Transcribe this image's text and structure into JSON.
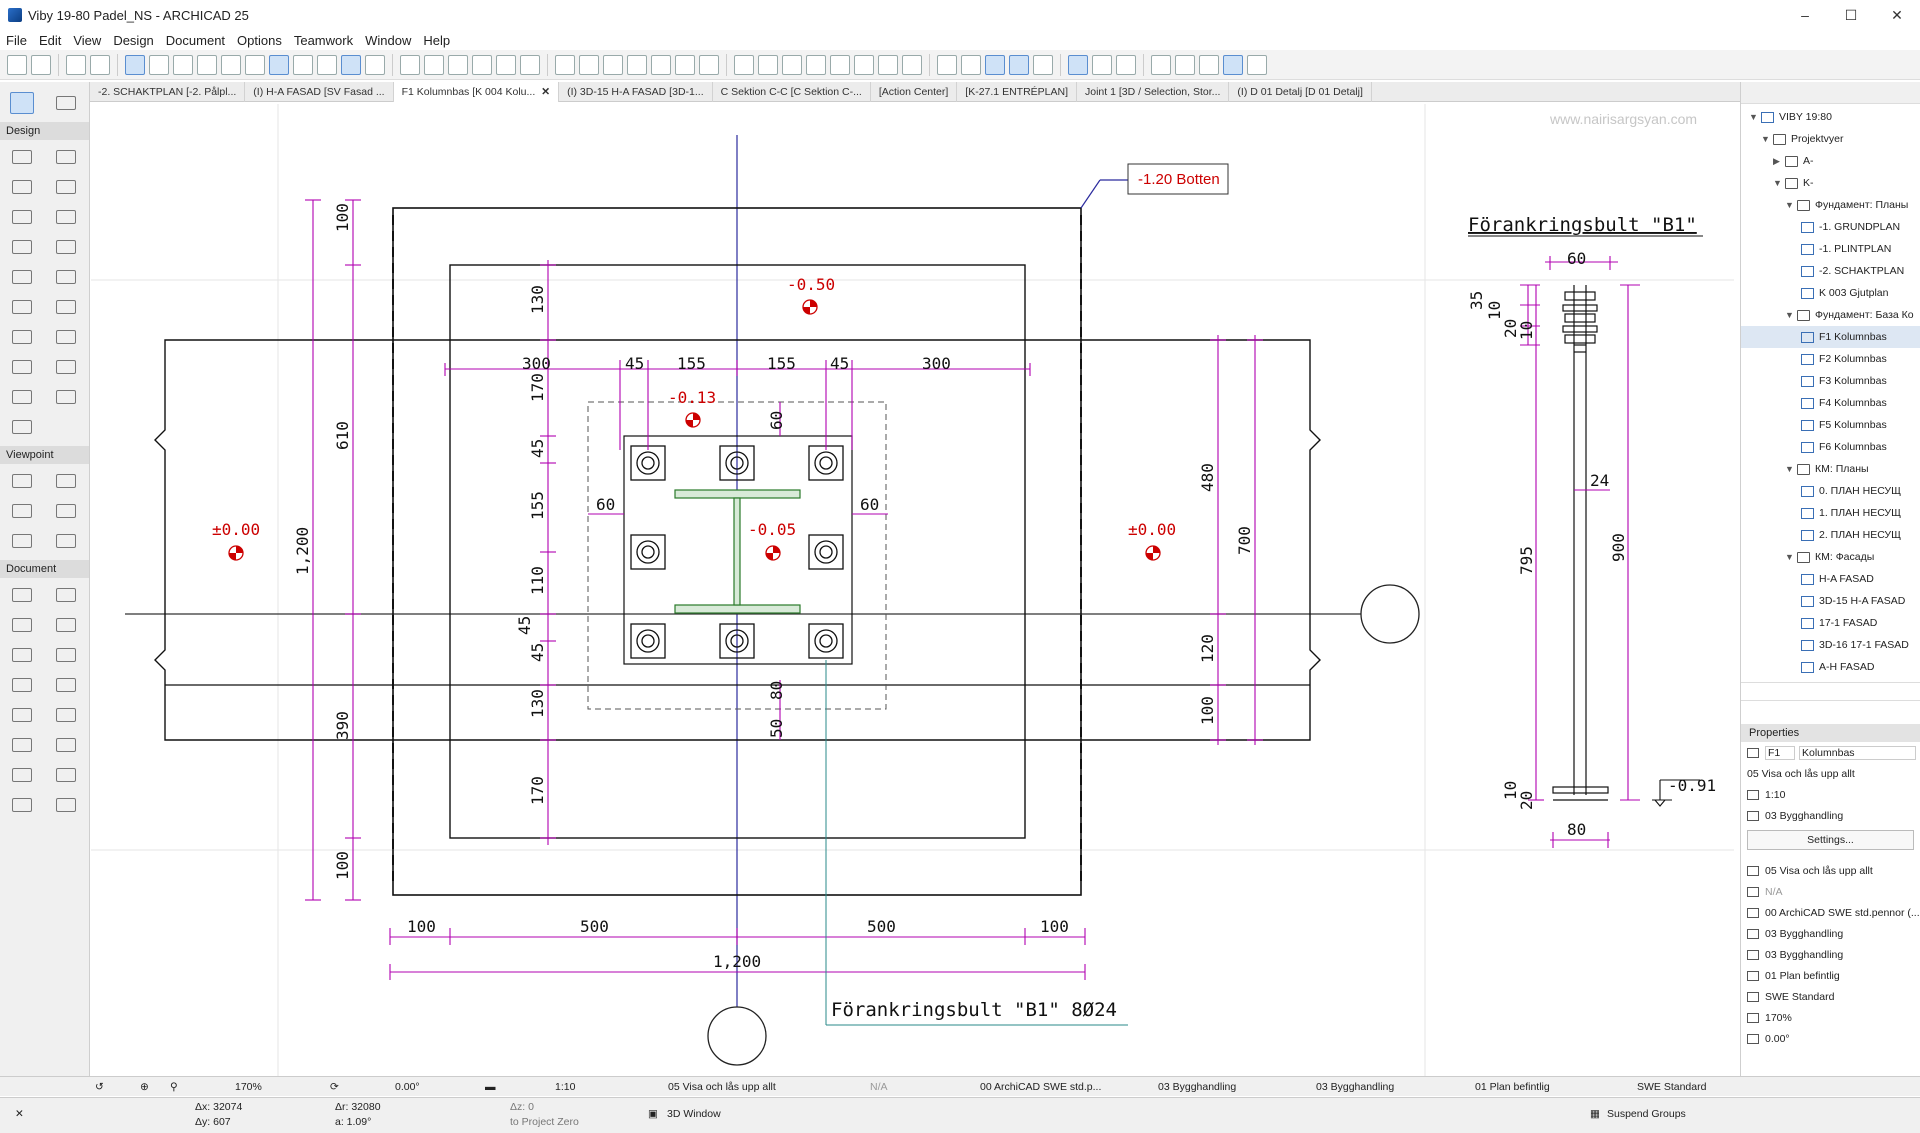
{
  "window": {
    "title": "Viby 19-80 Padel_NS - ARCHICAD 25"
  },
  "menu": [
    "File",
    "Edit",
    "View",
    "Design",
    "Document",
    "Options",
    "Teamwork",
    "Window",
    "Help"
  ],
  "tabs": [
    {
      "label": "-2. SCHAKTPLAN [-2. Pålpl...",
      "active": false
    },
    {
      "label": "(I) H-A FASAD  [SV Fasad ...",
      "active": false
    },
    {
      "label": "F1 Kolumnbas [K 004 Kolu...",
      "active": true
    },
    {
      "label": "(I) 3D-15 H-A FASAD [3D-1...",
      "active": false
    },
    {
      "label": "C Sektion C-C [C Sektion C-...",
      "active": false
    },
    {
      "label": "[Action Center]",
      "active": false
    },
    {
      "label": "[K-27.1 ENTRÉPLAN]",
      "active": false
    },
    {
      "label": "Joint 1 [3D / Selection, Stor...",
      "active": false
    },
    {
      "label": "(I) D 01 Detalj [D 01 Detalj]",
      "active": false
    }
  ],
  "toolbox": {
    "design": "Design",
    "viewpoint": "Viewpoint",
    "document": "Document"
  },
  "watermark": "www.nairisargsyan.com",
  "drawing": {
    "levels": [
      "-0.50",
      "-0.13",
      "-0.05",
      "±0.00",
      "±0.00"
    ],
    "callout": "-1.20 Botten",
    "detail_title": "Förankringsbult \"B1\"",
    "bolt_label": "Förankringsbult \"B1\" 8Ø24",
    "bolt_level": "-0.91",
    "dims_top": [
      "300",
      "45",
      "155",
      "155",
      "45",
      "300"
    ],
    "dims_bottom": [
      "100",
      "500",
      "500",
      "100"
    ],
    "dim_total_bottom": "1,200",
    "dims_left_outer": [
      "100",
      "610",
      "390",
      "100"
    ],
    "dim_left_total": "1,200",
    "dims_left_inner": [
      "130",
      "170",
      "45",
      "155",
      "110",
      "45",
      "45",
      "130",
      "170"
    ],
    "dims_right": [
      "480",
      "700",
      "120",
      "100"
    ],
    "dims_inner": [
      "60",
      "60",
      "60",
      "80",
      "50"
    ],
    "detail_dims": [
      "60",
      "35",
      "10",
      "20",
      "10",
      "24",
      "795",
      "900",
      "10",
      "20",
      "80"
    ]
  },
  "navigator": {
    "root": "VIBY 19:80",
    "items": [
      {
        "label": "Projektvyer",
        "depth": 1,
        "type": "folder",
        "open": true
      },
      {
        "label": "A-",
        "depth": 2,
        "type": "folder",
        "open": false
      },
      {
        "label": "K-",
        "depth": 2,
        "type": "folder",
        "open": true
      },
      {
        "label": "Фундамент: Планы",
        "depth": 3,
        "type": "folder",
        "open": true
      },
      {
        "label": "-1. GRUNDPLAN",
        "depth": 4,
        "type": "view"
      },
      {
        "label": "-1. PLINTPLAN",
        "depth": 4,
        "type": "view"
      },
      {
        "label": "-2. SCHAKTPLAN",
        "depth": 4,
        "type": "view"
      },
      {
        "label": "K 003 Gjutplan",
        "depth": 4,
        "type": "view"
      },
      {
        "label": "Фундамент: База Ко",
        "depth": 3,
        "type": "folder",
        "open": true
      },
      {
        "label": "F1 Kolumnbas",
        "depth": 4,
        "type": "view",
        "selected": true
      },
      {
        "label": "F2 Kolumnbas",
        "depth": 4,
        "type": "view"
      },
      {
        "label": "F3 Kolumnbas",
        "depth": 4,
        "type": "view"
      },
      {
        "label": "F4 Kolumnbas",
        "depth": 4,
        "type": "view"
      },
      {
        "label": "F5 Kolumnbas",
        "depth": 4,
        "type": "view"
      },
      {
        "label": "F6 Kolumnbas",
        "depth": 4,
        "type": "view"
      },
      {
        "label": "КМ: Планы",
        "depth": 3,
        "type": "folder",
        "open": true
      },
      {
        "label": "0. ПЛАН НЕСУЩ",
        "depth": 4,
        "type": "view"
      },
      {
        "label": "1. ПЛАН НЕСУЩ",
        "depth": 4,
        "type": "view"
      },
      {
        "label": "2. ПЛАН НЕСУЩ",
        "depth": 4,
        "type": "view"
      },
      {
        "label": "КМ: Фасады",
        "depth": 3,
        "type": "folder",
        "open": true
      },
      {
        "label": "H-A FASAD",
        "depth": 4,
        "type": "view"
      },
      {
        "label": "3D-15 H-A FASAD",
        "depth": 4,
        "type": "view"
      },
      {
        "label": "17-1  FASAD",
        "depth": 4,
        "type": "view"
      },
      {
        "label": "3D-16 17-1 FASAD",
        "depth": 4,
        "type": "view"
      },
      {
        "label": "A-H FASAD",
        "depth": 4,
        "type": "view"
      }
    ]
  },
  "properties": {
    "header": "Properties",
    "id": "F1",
    "name": "Kolumnbas",
    "layer_combo": "05 Visa och lås upp allt",
    "scale": "1:10",
    "structure": "03 Bygghandling",
    "settings_label": "Settings...",
    "rows": [
      "05 Visa och lås upp allt",
      "N/A",
      "00 ArchiCAD SWE std.pennor (...",
      "03 Bygghandling",
      "03 Bygghandling",
      "01 Plan befintlig",
      "SWE Standard",
      "170%",
      "0.00°"
    ]
  },
  "statusbar": {
    "zoom": "170%",
    "angle": "0.00°",
    "scale": "1:10",
    "layer": "05 Visa och lås upp allt",
    "na": "N/A",
    "pen": "00 ArchiCAD SWE std.p...",
    "model": "03 Bygghandling",
    "structure": "03 Bygghandling",
    "renovation": "01 Plan befintlig",
    "dim_std": "SWE Standard"
  },
  "coords": {
    "dx": "Δx: 32074",
    "dy": "Δy: 607",
    "dr": "Δr: 32080",
    "da": "a: 1.09°",
    "dz": "Δz: 0",
    "zref": "to Project Zero"
  },
  "bottom": {
    "window3d": "3D Window",
    "suspend": "Suspend Groups"
  },
  "colors": {
    "dim": "#b000b0",
    "level": "#cc0000",
    "accent": "#2a6fc9"
  }
}
